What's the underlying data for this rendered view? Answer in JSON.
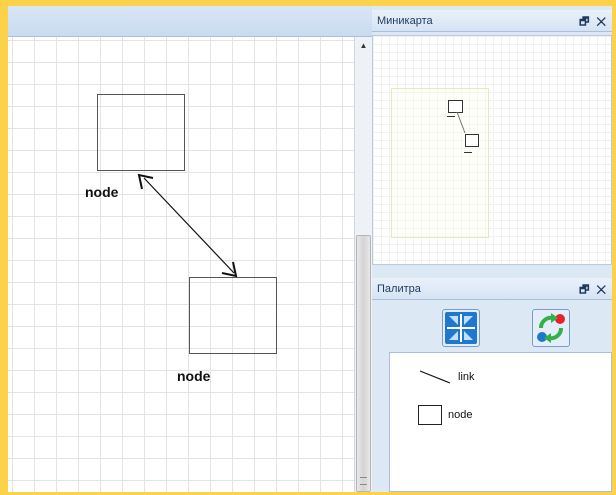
{
  "canvas": {
    "nodes": [
      {
        "label": "node"
      },
      {
        "label": "node"
      }
    ]
  },
  "minimap": {
    "title": "Миникарта",
    "controls": "🗗 ✕"
  },
  "palette": {
    "title": "Палитра",
    "controls": "🗗 ✕",
    "tools": [
      {
        "name": "fit-to-screen",
        "icon": "arrows-in-icon"
      },
      {
        "name": "auto-layout",
        "icon": "circular-arrows-icon"
      }
    ],
    "items": [
      {
        "label": "link",
        "icon": "line-icon"
      },
      {
        "label": "node",
        "icon": "rectangle-icon"
      }
    ]
  },
  "colors": {
    "frame_border": "#fbd24a",
    "panel_bg": "#dde8f5",
    "tool_blue": "#1f77d0",
    "tool_green": "#33b04a",
    "tool_red": "#e3242b"
  }
}
